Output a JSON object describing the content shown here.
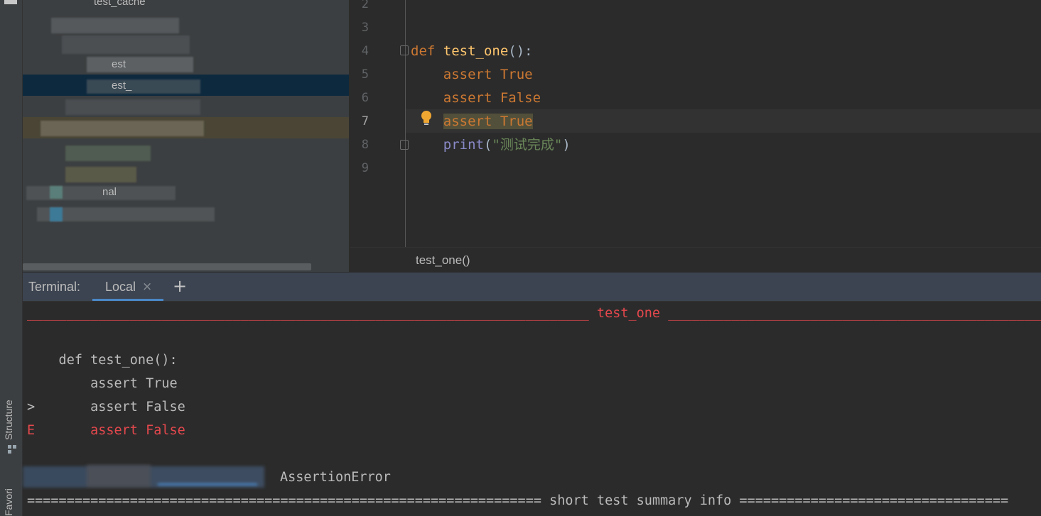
{
  "left_strip": {
    "structure_label": "Structure",
    "favorites_label": "Favori"
  },
  "project_tree": {
    "visible_fragments": [
      "test_cache",
      "est",
      "est_",
      "nal"
    ]
  },
  "editor": {
    "line_numbers": [
      "2",
      "3",
      "4",
      "5",
      "6",
      "7",
      "8",
      "9"
    ],
    "current_line": "7",
    "code": {
      "def_kw": "def",
      "func_name": "test_one",
      "func_tail": "():",
      "assert_kw": "assert",
      "true_kw": "True",
      "false_kw": "False",
      "print_fn": "print",
      "print_open": "(",
      "print_str": "\"测试完成\"",
      "print_close": ")"
    },
    "breadcrumb": "test_one()"
  },
  "terminal": {
    "title": "Terminal:",
    "tab_label": "Local",
    "tab_close": "×",
    "add_tab": "+",
    "lines": {
      "sep_left": "_______________________________________________________________________",
      "sep_title": " test_one ",
      "sep_right": "________________________________________________________________________",
      "def_line": "    def test_one():",
      "assert_true": "        assert True",
      "marker_arrow": ">",
      "assert_false": "       assert False",
      "marker_e": "E",
      "error_false": "       assert False",
      "assertion_error": "AssertionError",
      "summary_left": "=================================================================",
      "summary_title": " short test summary info ",
      "summary_right": "=================================="
    }
  },
  "colors": {
    "editor_bg": "#2b2b2b",
    "panel_bg": "#3c3f41",
    "keyword": "#cc7832",
    "function": "#ffc66d",
    "string": "#6a8759",
    "error": "#e5484d",
    "tab_accent": "#4a88c7"
  }
}
